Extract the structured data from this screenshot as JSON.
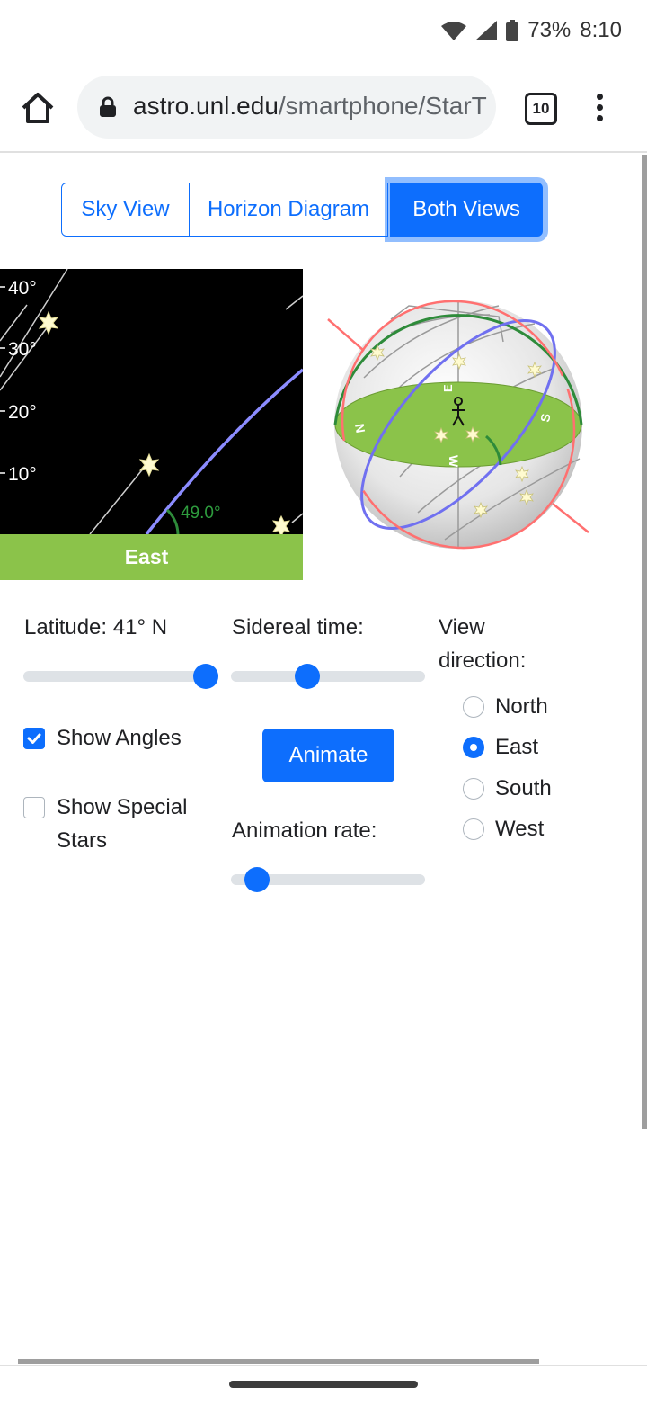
{
  "status_bar": {
    "battery": "73%",
    "time": "8:10"
  },
  "browser": {
    "url_host": "astro.unl.edu",
    "url_path": "/smartphone/StarT",
    "tab_count": "10"
  },
  "view_tabs": [
    {
      "label": "Sky View",
      "active": false
    },
    {
      "label": "Horizon Diagram",
      "active": false
    },
    {
      "label": "Both Views",
      "active": true
    }
  ],
  "sky_view": {
    "altitude_labels": [
      "40°",
      "30°",
      "20°",
      "10°"
    ],
    "angle_label": "49.0°",
    "horizon_label": "East"
  },
  "horizon_diagram": {
    "cardinal_labels": [
      "E",
      "N",
      "S",
      "W"
    ]
  },
  "controls": {
    "latitude_label": "Latitude: 41° N",
    "latitude_value": 41,
    "sidereal_label": "Sidereal time:",
    "view_direction_label_1": "View",
    "view_direction_label_2": "direction:",
    "show_angles_label": "Show Angles",
    "show_angles_checked": true,
    "show_special_label_1": "Show Special",
    "show_special_label_2": "Stars",
    "show_special_checked": false,
    "animate_label": "Animate",
    "animation_rate_label": "Animation rate:",
    "directions": [
      "North",
      "East",
      "South",
      "West"
    ],
    "selected_direction": "East"
  },
  "colors": {
    "accent": "#0d6efd",
    "horizon_green": "#8bc34a",
    "celestial_equator": "#8080ff",
    "ecliptic": "#ff7070"
  }
}
